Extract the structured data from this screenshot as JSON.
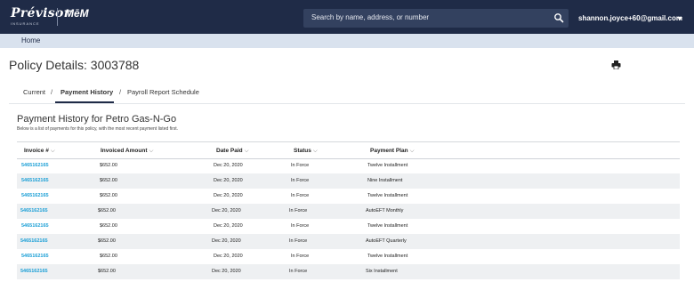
{
  "header": {
    "logo_name": "Prévisor",
    "logo_sub": "INSURANCE",
    "logo_mem": "MēM",
    "search_placeholder": "Search by name, address, or number",
    "user_email": "shannon.joyce+60@gmail.com"
  },
  "breadcrumb": {
    "home": "Home"
  },
  "page": {
    "title": "Policy Details: 3003788"
  },
  "tabs": [
    {
      "label": "Current",
      "active": false
    },
    {
      "label": "Payment History",
      "active": true
    },
    {
      "label": "Payroll Report Schedule",
      "active": false
    }
  ],
  "tab_separator": "/",
  "section": {
    "title": "Payment History for Petro Gas-N-Go",
    "description": "Below is a list of payments for this policy, with the most recent payment listed first."
  },
  "table": {
    "columns": [
      "Invoice #",
      "Invoiced Amount",
      "Date Paid",
      "Status",
      "Payment Plan"
    ],
    "sort_glyph": "⌵",
    "rows": [
      [
        "5465162165",
        "$652.00",
        "Dec 20, 2020",
        "In Force",
        "Twelve Installment"
      ],
      [
        "5465162165",
        "$652.00",
        "Dec 20, 2020",
        "In Force",
        "Nine Installment"
      ],
      [
        "5465162165",
        "$652.00",
        "Dec 20, 2020",
        "In Force",
        "Twelve Installment"
      ],
      [
        "5465162165",
        "$652.00",
        "Dec 20, 2020",
        "In Force",
        "AutoEFT Monthly"
      ],
      [
        "5465162165",
        "$652.00",
        "Dec 20, 2020",
        "In Force",
        "Twelve Installment"
      ],
      [
        "5465162165",
        "$652.00",
        "Dec 20, 2020",
        "In Force",
        "AutoEFT Quarterly"
      ],
      [
        "5465162165",
        "$652.00",
        "Dec 20, 2020",
        "In Force",
        "Twelve Installment"
      ],
      [
        "5465162165",
        "$652.00",
        "Dec 20, 2020",
        "In Force",
        "Six Installment"
      ]
    ]
  },
  "colors": {
    "header_bg": "#1f2b47",
    "search_bg": "#33415f",
    "crumb_bg": "#d9e2ee",
    "link": "#1a9fd6",
    "alt_row": "#eef0f2"
  },
  "icons": {
    "search": "search-icon",
    "print": "print-icon",
    "user_menu": "chevron-down-icon"
  }
}
